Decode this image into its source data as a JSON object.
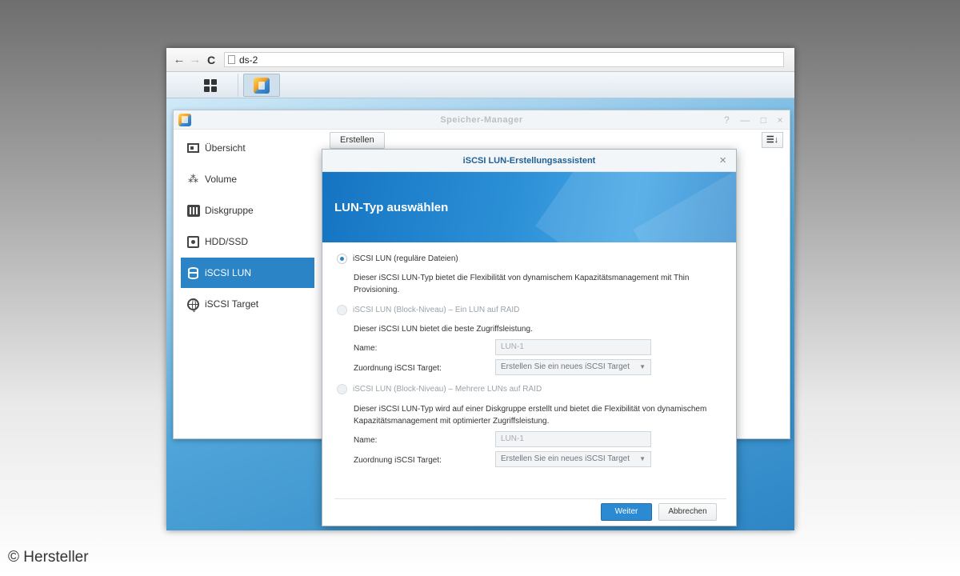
{
  "browser": {
    "back_icon": "arrow-left-icon",
    "forward_icon": "arrow-right-icon",
    "reload_icon": "reload-icon",
    "url": "ds-2"
  },
  "window": {
    "title": "Speicher-Manager",
    "controls": [
      "?",
      "—",
      "□",
      "×"
    ]
  },
  "sidebar": {
    "items": [
      {
        "label": "Übersicht",
        "icon": "overview-card-icon"
      },
      {
        "label": "Volume",
        "icon": "volume-cubes-icon"
      },
      {
        "label": "Diskgruppe",
        "icon": "diskgroup-icon"
      },
      {
        "label": "HDD/SSD",
        "icon": "hdd-icon"
      },
      {
        "label": "iSCSI LUN",
        "icon": "database-icon",
        "active": true
      },
      {
        "label": "iSCSI Target",
        "icon": "globe-icon"
      }
    ]
  },
  "toolbar": {
    "create_label": "Erstellen",
    "sort_label": "☰↓"
  },
  "wizard": {
    "title": "iSCSI LUN-Erstellungsassistent",
    "close": "×",
    "heading": "LUN-Typ auswählen",
    "options": [
      {
        "label": "iSCSI LUN (reguläre Dateien)",
        "selected": true,
        "enabled": true,
        "description": "Dieser iSCSI LUN-Typ bietet die Flexibilität von dynamischem Kapazitätsmanagement mit Thin Provisioning."
      },
      {
        "label": "iSCSI LUN (Block-Niveau) – Ein LUN auf RAID",
        "selected": false,
        "enabled": false,
        "description": "Dieser iSCSI LUN bietet die beste Zugriffsleistung.",
        "name_label": "Name:",
        "name_value": "LUN-1",
        "target_label": "Zuordnung iSCSI Target:",
        "target_value": "Erstellen Sie ein neues iSCSI Target"
      },
      {
        "label": "iSCSI LUN (Block-Niveau) – Mehrere LUNs auf RAID",
        "selected": false,
        "enabled": false,
        "description": "Dieser iSCSI LUN-Typ wird auf einer Diskgruppe erstellt und bietet die Flexibilität von dynamischem Kapazitätsmanagement mit optimierter Zugriffsleistung.",
        "name_label": "Name:",
        "name_value": "LUN-1",
        "target_label": "Zuordnung iSCSI Target:",
        "target_value": "Erstellen Sie ein neues iSCSI Target"
      }
    ],
    "next_label": "Weiter",
    "cancel_label": "Abbrechen"
  },
  "copyright": "© Hersteller",
  "colors": {
    "accent": "#2b84c6",
    "banner": "#1f80cc"
  }
}
